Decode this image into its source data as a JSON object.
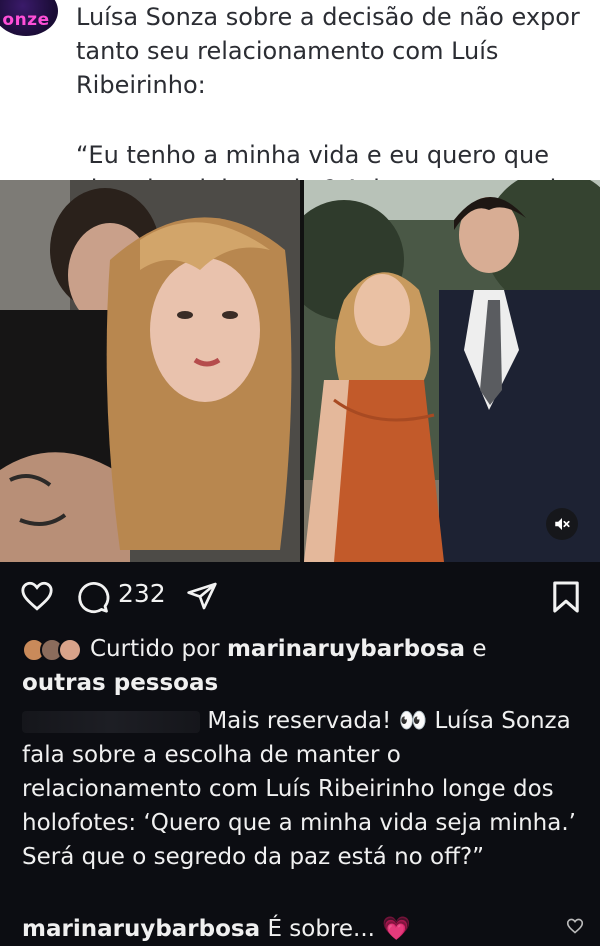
{
  "header": {
    "brand_logo_text": "onze",
    "headline": "Luísa Sonza sobre a decisão de não expor tanto seu relacionamento com Luís Ribeirinho:",
    "quote": "“Eu tenho a minha vida e eu quero que ela seja minha, sabe? Acho que por muito tempo eu não entendia isso.”"
  },
  "actions": {
    "comment_count": "232",
    "icons": [
      "heart-icon",
      "comment-icon",
      "share-icon",
      "bookmark-icon"
    ]
  },
  "likes": {
    "prefix": "Curtido por",
    "user": "marinaruybarbosa",
    "connector": "e",
    "suffix": "outras pessoas",
    "avatar_colors": [
      "#c98a5a",
      "#8b6c5c",
      "#d9a38a"
    ]
  },
  "caption": {
    "text": "Mais reservada! 👀 Luísa Sonza fala sobre a escolha de manter o relacionamento com Luís Ribeirinho longe dos holofotes: ‘Quero que a minha vida seja minha.’ Será que o segredo da paz está no off?”"
  },
  "comment": {
    "user": "marinaruybarbosa",
    "text": "É sobre... 💗"
  },
  "colors": {
    "background": "#0c0d12",
    "text": "#f0f0f0",
    "header_text": "#2b2d33",
    "brand_pink": "#ff4fd8"
  }
}
